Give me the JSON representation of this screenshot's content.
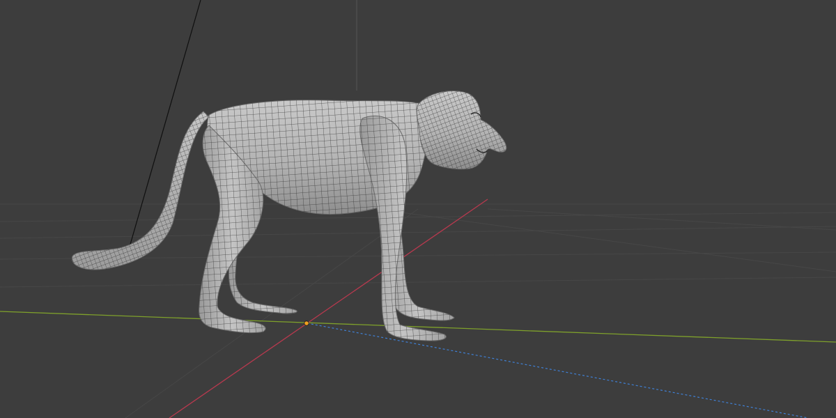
{
  "app": {
    "name": "3D viewport"
  },
  "viewport": {
    "background": "#3d3d3d",
    "grid_color": "#474747",
    "x_axis_color": "#b8394e",
    "y_axis_color": "#7fa12b",
    "z_axis_color": "#3f80d6",
    "origin_color": "#f0a020"
  },
  "object": {
    "name": "monkey-mesh",
    "shading": "solid-wireframe",
    "base_color": "#b9b9b9",
    "wire_color": "#2a2a2a"
  }
}
